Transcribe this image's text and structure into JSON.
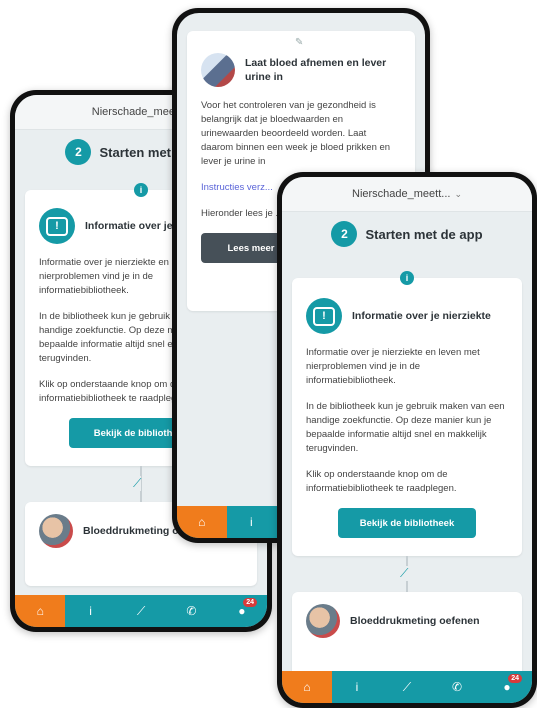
{
  "app_header": {
    "title": "Nierschade_meett...",
    "chevron": "chevron-down-icon"
  },
  "step": {
    "number": "2",
    "label": "Starten met de app"
  },
  "info_card": {
    "title": "Informatie over je nierziekte",
    "para1": "Informatie over je nierziekte en leven met nierproblemen vind je in de informatiebibliotheek.",
    "para2": "In de bibliotheek kun je gebruik maken van een handige zoekfunctie. Op deze manier kun je bepaalde informatie altijd snel en makkelijk terugvinden.",
    "para3": "Klik op onderstaande knop om de informatiebibliotheek te raadplegen.",
    "button": "Bekijk de bibliotheek"
  },
  "blood_card": {
    "title": "Laat bloed afnemen en lever urine in",
    "para1": "Voor het controleren van je gezondheid is belangrijk dat je bloedwaarden en urinewaarden beoordeeld worden. Laat daarom binnen een week je bloed prikken en lever je urine in",
    "link": "Instructies verz...",
    "para2": "Hieronder lees je ... en hoe het werkt",
    "button": "Lees meer"
  },
  "practice_card": {
    "title": "Bloeddrukmeting oefenen"
  },
  "nav": {
    "tabs": [
      {
        "icon": "home-icon",
        "glyph": "⌂"
      },
      {
        "icon": "info-icon",
        "glyph": "i"
      },
      {
        "icon": "chart-icon",
        "glyph": "⟋"
      },
      {
        "icon": "phone-icon",
        "glyph": "✆"
      },
      {
        "icon": "profile-icon",
        "glyph": "●",
        "badge": "24"
      }
    ]
  }
}
